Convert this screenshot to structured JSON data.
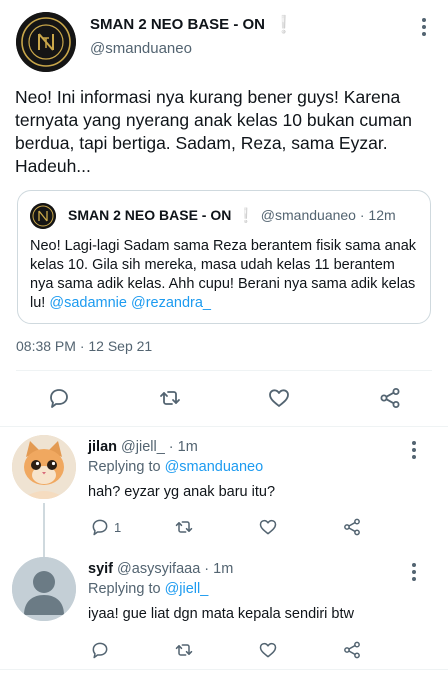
{
  "tweet": {
    "name": "SMAN 2 NEO BASE - ON",
    "verified_mark": "❕",
    "handle": "@smanduaneo",
    "text": "Neo! Ini informasi nya kurang bener guys! Karena ternyata yang nyerang anak kelas 10 bukan cuman berdua, tapi bertiga. Sadam, Reza, sama Eyzar.  Hadeuh...",
    "timestamp": "08:38 PM · 12 Sep 21",
    "avatar_icon": "school-emblem-icon",
    "avatar_ring_color": "#c9a74a"
  },
  "quote": {
    "name": "SMAN 2 NEO BASE - ON",
    "verified_mark": "❕",
    "handle_time": "@smanduaneo · 12m",
    "text_plain": "Neo! Lagi-lagi Sadam sama Reza berantem fisik sama anak kelas 10. Gila sih mereka, masa udah kelas 11 berantem nya sama adik kelas. Ahh cupu! Berani nya sama adik kelas lu! ",
    "mention_1": "@sadamnie",
    "mention_2": "@rezandra_"
  },
  "actions": {
    "reply_icon": "reply-icon",
    "retweet_icon": "retweet-icon",
    "like_icon": "like-icon",
    "share_icon": "share-icon"
  },
  "replies": [
    {
      "name": "jilan",
      "meta": "@jiell_ · 1m",
      "replying_label": "Replying to ",
      "replying_to": "@smanduaneo",
      "text": "hah? eyzar yg anak baru itu?",
      "reply_count": "1",
      "avatar_icon": "kitten-photo-icon"
    },
    {
      "name": "syif",
      "meta": "@asysyifaaa · 1m",
      "replying_label": "Replying to ",
      "replying_to": "@jiell_",
      "text": "iyaa! gue liat dgn mata kepala sendiri btw",
      "reply_count": "",
      "avatar_icon": "default-user-icon"
    }
  ],
  "colors": {
    "accent": "#1d9bf0",
    "muted": "#536471",
    "border": "#cfd9de"
  }
}
